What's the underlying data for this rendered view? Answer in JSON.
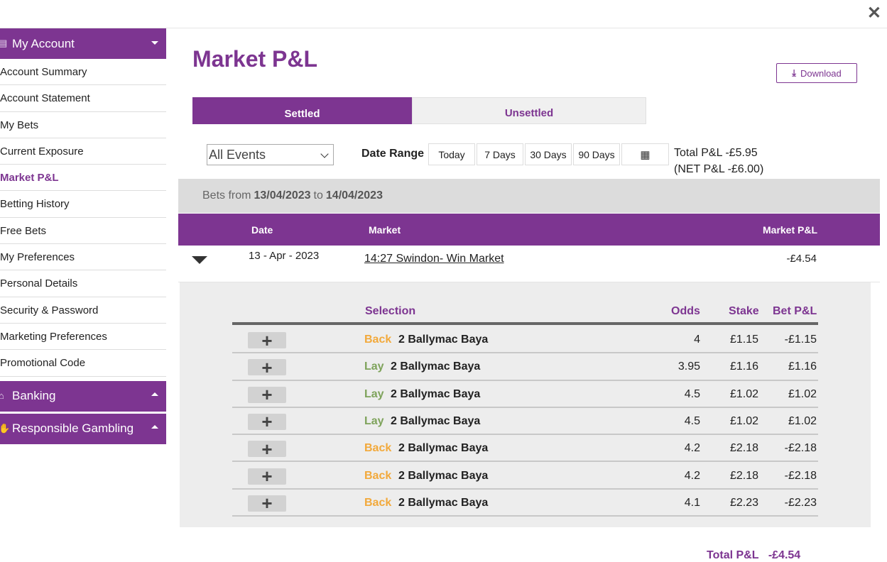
{
  "window": {
    "close_icon": "close-icon"
  },
  "sidebar": {
    "my_account": {
      "label": "My Account",
      "icon": "account-icon"
    },
    "items": [
      {
        "label": "Account Summary",
        "active": false
      },
      {
        "label": "Account Statement",
        "active": false
      },
      {
        "label": "My Bets",
        "active": false
      },
      {
        "label": "Current Exposure",
        "active": false
      },
      {
        "label": "Market P&L",
        "active": true
      },
      {
        "label": "Betting History",
        "active": false
      },
      {
        "label": "Free Bets",
        "active": false
      },
      {
        "label": "My Preferences",
        "active": false
      },
      {
        "label": "Personal Details",
        "active": false
      },
      {
        "label": "Security & Password",
        "active": false
      },
      {
        "label": "Marketing Preferences",
        "active": false
      },
      {
        "label": "Promotional Code",
        "active": false
      }
    ],
    "banking": {
      "label": "Banking",
      "icon": "bank-icon"
    },
    "responsible": {
      "label": "Responsible Gambling",
      "icon": "hand-icon"
    }
  },
  "main": {
    "title": "Market P&L",
    "download_label": "Download",
    "tabs": {
      "settled": "Settled",
      "unsettled": "Unsettled"
    },
    "filters": {
      "events_value": "All Events",
      "date_range_label": "Date Range",
      "ranges": [
        "Today",
        "7 Days",
        "30 Days",
        "90 Days"
      ],
      "total_pl": "Total P&L -£5.95",
      "net_pl": "(NET P&L -£6.00)"
    },
    "bets_from": {
      "prefix": "Bets from",
      "from": "13/04/2023",
      "to_word": "to",
      "to": "14/04/2023"
    },
    "table_head": {
      "date": "Date",
      "market": "Market",
      "market_pl": "Market P&L"
    },
    "market": {
      "date": "13 - Apr - 2023",
      "name": "14:27 Swindon- Win Market",
      "pl": "-£4.54"
    },
    "detail_head": {
      "selection": "Selection",
      "odds": "Odds",
      "stake": "Stake",
      "bet_pl": "Bet P&L"
    },
    "bets": [
      {
        "type": "Back",
        "selection": "2 Ballymac Baya",
        "odds": "4",
        "stake": "£1.15",
        "pl": "-£1.15"
      },
      {
        "type": "Lay",
        "selection": "2 Ballymac Baya",
        "odds": "3.95",
        "stake": "£1.16",
        "pl": "£1.16"
      },
      {
        "type": "Lay",
        "selection": "2 Ballymac Baya",
        "odds": "4.5",
        "stake": "£1.02",
        "pl": "£1.02"
      },
      {
        "type": "Lay",
        "selection": "2 Ballymac Baya",
        "odds": "4.5",
        "stake": "£1.02",
        "pl": "£1.02"
      },
      {
        "type": "Back",
        "selection": "2 Ballymac Baya",
        "odds": "4.2",
        "stake": "£2.18",
        "pl": "-£2.18"
      },
      {
        "type": "Back",
        "selection": "2 Ballymac Baya",
        "odds": "4.2",
        "stake": "£2.18",
        "pl": "-£2.18"
      },
      {
        "type": "Back",
        "selection": "2 Ballymac Baya",
        "odds": "4.1",
        "stake": "£2.23",
        "pl": "-£2.23"
      }
    ],
    "total_line": "Total P&L",
    "total_line_value": "-£4.54"
  },
  "colors": {
    "brand": "#7d3591",
    "back": "#f2a93b",
    "lay": "#7ea35b"
  }
}
